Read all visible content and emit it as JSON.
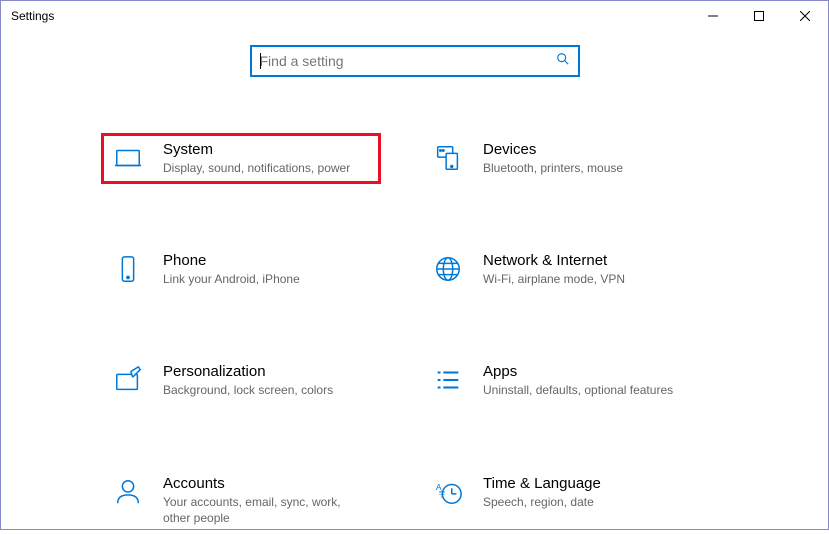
{
  "window": {
    "title": "Settings"
  },
  "search": {
    "placeholder": "Find a setting"
  },
  "categories": {
    "system": {
      "title": "System",
      "desc": "Display, sound, notifications, power"
    },
    "devices": {
      "title": "Devices",
      "desc": "Bluetooth, printers, mouse"
    },
    "phone": {
      "title": "Phone",
      "desc": "Link your Android, iPhone"
    },
    "network": {
      "title": "Network & Internet",
      "desc": "Wi-Fi, airplane mode, VPN"
    },
    "personalization": {
      "title": "Personalization",
      "desc": "Background, lock screen, colors"
    },
    "apps": {
      "title": "Apps",
      "desc": "Uninstall, defaults, optional features"
    },
    "accounts": {
      "title": "Accounts",
      "desc": "Your accounts, email, sync, work, other people"
    },
    "time": {
      "title": "Time & Language",
      "desc": "Speech, region, date"
    }
  }
}
